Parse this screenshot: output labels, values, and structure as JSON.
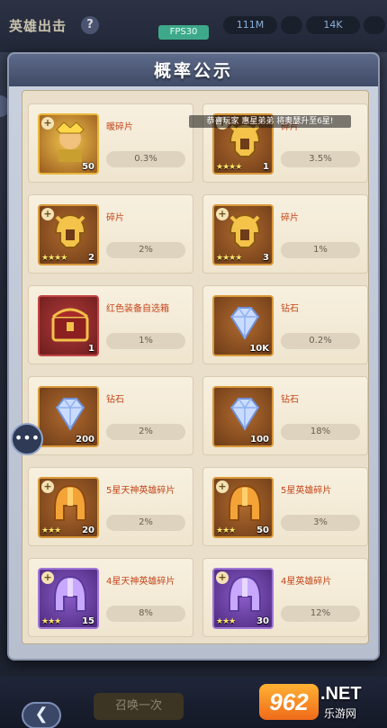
{
  "background": {
    "title": "英雄出击",
    "help_label": "?",
    "resources": [
      "111M",
      "",
      "14K",
      ""
    ],
    "footer_button_label": "召唤一次",
    "back_label": "❮"
  },
  "modal": {
    "title": "概率公示",
    "fps_label": "FPS30",
    "toast": "恭喜玩家 惠星弟弟 将奥瑟升至6星!"
  },
  "side": {
    "chat_icon": "chat-bubble-icon"
  },
  "items": [
    {
      "name": "暖碎片",
      "probability": "0.3%",
      "count": "50",
      "stars": 0,
      "icon": "hero-portrait-icon",
      "frame": "gold"
    },
    {
      "name": "碎片",
      "probability": "3.5%",
      "count": "1",
      "stars": 4,
      "icon": "helmet-emblem-icon",
      "frame": "orange"
    },
    {
      "name": "碎片",
      "probability": "2%",
      "count": "2",
      "stars": 4,
      "icon": "helmet-emblem-icon",
      "frame": "orange"
    },
    {
      "name": "碎片",
      "probability": "1%",
      "count": "3",
      "stars": 4,
      "icon": "helmet-emblem-icon",
      "frame": "orange"
    },
    {
      "name": "红色装备自选箱",
      "probability": "1%",
      "count": "1",
      "stars": 0,
      "icon": "treasure-chest-icon",
      "frame": "red"
    },
    {
      "name": "钻石",
      "probability": "0.2%",
      "count": "10K",
      "stars": 0,
      "icon": "diamond-icon",
      "frame": "orange"
    },
    {
      "name": "钻石",
      "probability": "2%",
      "count": "200",
      "stars": 0,
      "icon": "diamond-icon",
      "frame": "orange"
    },
    {
      "name": "钻石",
      "probability": "18%",
      "count": "100",
      "stars": 0,
      "icon": "diamond-icon",
      "frame": "orange"
    },
    {
      "name": "5星天神英雄碎片",
      "probability": "2%",
      "count": "20",
      "stars": 3,
      "icon": "orange-helmet-icon",
      "frame": "orange"
    },
    {
      "name": "5星英雄碎片",
      "probability": "3%",
      "count": "50",
      "stars": 3,
      "icon": "orange-helmet-icon",
      "frame": "orange"
    },
    {
      "name": "4星天神英雄碎片",
      "probability": "8%",
      "count": "15",
      "stars": 3,
      "icon": "purple-helmet-icon",
      "frame": "purple"
    },
    {
      "name": "4星英雄碎片",
      "probability": "12%",
      "count": "30",
      "stars": 3,
      "icon": "purple-helmet-icon",
      "frame": "purple"
    }
  ],
  "watermark": {
    "logo": "962",
    "suffix": ".NET",
    "site": "乐游网"
  },
  "colors": {
    "accent_orange": "#c4461a",
    "panel_bg": "#e9dfcb",
    "header_bg": "#4f5b7a"
  }
}
